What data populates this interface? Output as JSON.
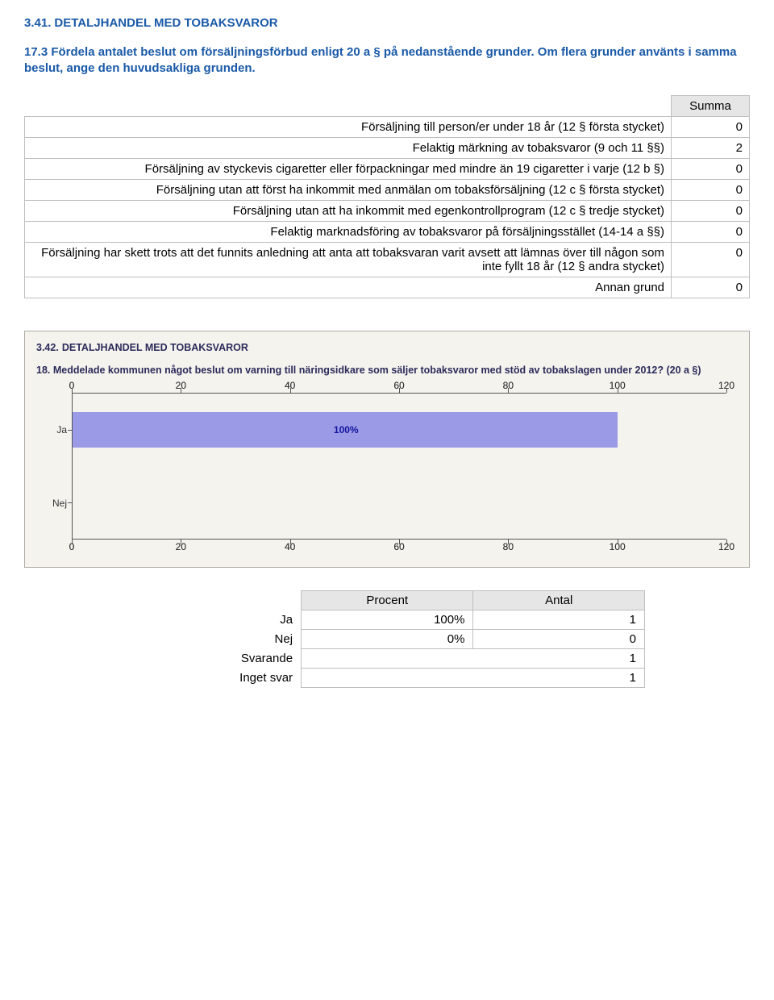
{
  "section1": {
    "num": "3.41.",
    "title": "DETALJHANDEL MED TOBAKSVAROR",
    "question": "17.3 Fördela antalet beslut om försäljningsförbud enligt 20 a § på nedanstående grunder. Om flera grunder använts i samma beslut, ange den huvudsakliga grunden.",
    "col_header": "Summa",
    "rows": [
      {
        "label": "Försäljning till person/er under 18 år (12 § första stycket)",
        "val": "0"
      },
      {
        "label": "Felaktig märkning av tobaksvaror (9 och 11 §§)",
        "val": "2"
      },
      {
        "label": "Försäljning av styckevis cigaretter eller förpackningar med mindre än 19 cigaretter i varje (12 b §)",
        "val": "0"
      },
      {
        "label": "Försäljning utan att först ha inkommit med anmälan om tobaksförsäljning (12 c § första stycket)",
        "val": "0"
      },
      {
        "label": "Försäljning utan att ha inkommit med egenkontrollprogram (12 c § tredje stycket)",
        "val": "0"
      },
      {
        "label": "Felaktig marknadsföring av tobaksvaror på försäljningsstället (14-14 a §§)",
        "val": "0"
      },
      {
        "label": "Försäljning har skett trots att det funnits anledning att anta att tobaksvaran varit avsett att lämnas över till någon som inte fyllt 18 år (12 § andra stycket)",
        "val": "0"
      },
      {
        "label": "Annan grund",
        "val": "0"
      }
    ]
  },
  "section2": {
    "num": "3.42.",
    "title": "DETALJHANDEL MED TOBAKSVAROR",
    "question": "18. Meddelade kommunen något beslut om varning till näringsidkare som säljer tobaksvaror med stöd av tobakslagen under 2012? (20 a §)"
  },
  "chart_data": {
    "type": "bar",
    "orientation": "horizontal",
    "categories": [
      "Ja",
      "Nej"
    ],
    "values": [
      100,
      0
    ],
    "value_labels": [
      "100%",
      ""
    ],
    "xlim": [
      0,
      120
    ],
    "xticks": [
      0,
      20,
      40,
      60,
      80,
      100,
      120
    ],
    "bar_color": "#9a9ae6",
    "label_color": "#1414a0"
  },
  "result_table": {
    "headers": [
      "Procent",
      "Antal"
    ],
    "rows": [
      {
        "label": "Ja",
        "pct": "100%",
        "antal": "1"
      },
      {
        "label": "Nej",
        "pct": "0%",
        "antal": "0"
      },
      {
        "label": "Svarande",
        "pct": "",
        "antal": "1"
      },
      {
        "label": "Inget svar",
        "pct": "",
        "antal": "1"
      }
    ]
  }
}
